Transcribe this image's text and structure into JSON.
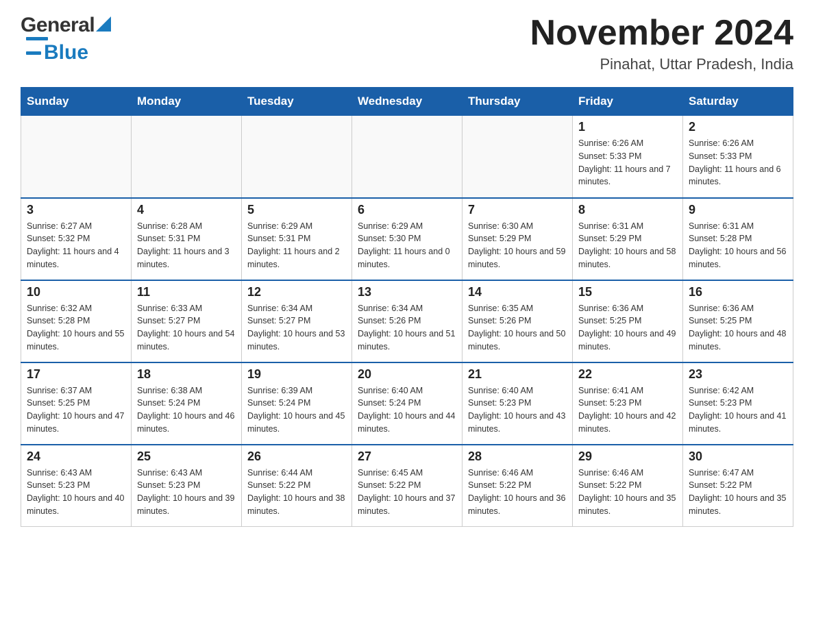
{
  "header": {
    "logo_general": "General",
    "logo_blue": "Blue",
    "month_title": "November 2024",
    "location": "Pinahat, Uttar Pradesh, India"
  },
  "days_of_week": [
    "Sunday",
    "Monday",
    "Tuesday",
    "Wednesday",
    "Thursday",
    "Friday",
    "Saturday"
  ],
  "weeks": [
    {
      "days": [
        {
          "num": "",
          "info": ""
        },
        {
          "num": "",
          "info": ""
        },
        {
          "num": "",
          "info": ""
        },
        {
          "num": "",
          "info": ""
        },
        {
          "num": "",
          "info": ""
        },
        {
          "num": "1",
          "info": "Sunrise: 6:26 AM\nSunset: 5:33 PM\nDaylight: 11 hours and 7 minutes."
        },
        {
          "num": "2",
          "info": "Sunrise: 6:26 AM\nSunset: 5:33 PM\nDaylight: 11 hours and 6 minutes."
        }
      ]
    },
    {
      "days": [
        {
          "num": "3",
          "info": "Sunrise: 6:27 AM\nSunset: 5:32 PM\nDaylight: 11 hours and 4 minutes."
        },
        {
          "num": "4",
          "info": "Sunrise: 6:28 AM\nSunset: 5:31 PM\nDaylight: 11 hours and 3 minutes."
        },
        {
          "num": "5",
          "info": "Sunrise: 6:29 AM\nSunset: 5:31 PM\nDaylight: 11 hours and 2 minutes."
        },
        {
          "num": "6",
          "info": "Sunrise: 6:29 AM\nSunset: 5:30 PM\nDaylight: 11 hours and 0 minutes."
        },
        {
          "num": "7",
          "info": "Sunrise: 6:30 AM\nSunset: 5:29 PM\nDaylight: 10 hours and 59 minutes."
        },
        {
          "num": "8",
          "info": "Sunrise: 6:31 AM\nSunset: 5:29 PM\nDaylight: 10 hours and 58 minutes."
        },
        {
          "num": "9",
          "info": "Sunrise: 6:31 AM\nSunset: 5:28 PM\nDaylight: 10 hours and 56 minutes."
        }
      ]
    },
    {
      "days": [
        {
          "num": "10",
          "info": "Sunrise: 6:32 AM\nSunset: 5:28 PM\nDaylight: 10 hours and 55 minutes."
        },
        {
          "num": "11",
          "info": "Sunrise: 6:33 AM\nSunset: 5:27 PM\nDaylight: 10 hours and 54 minutes."
        },
        {
          "num": "12",
          "info": "Sunrise: 6:34 AM\nSunset: 5:27 PM\nDaylight: 10 hours and 53 minutes."
        },
        {
          "num": "13",
          "info": "Sunrise: 6:34 AM\nSunset: 5:26 PM\nDaylight: 10 hours and 51 minutes."
        },
        {
          "num": "14",
          "info": "Sunrise: 6:35 AM\nSunset: 5:26 PM\nDaylight: 10 hours and 50 minutes."
        },
        {
          "num": "15",
          "info": "Sunrise: 6:36 AM\nSunset: 5:25 PM\nDaylight: 10 hours and 49 minutes."
        },
        {
          "num": "16",
          "info": "Sunrise: 6:36 AM\nSunset: 5:25 PM\nDaylight: 10 hours and 48 minutes."
        }
      ]
    },
    {
      "days": [
        {
          "num": "17",
          "info": "Sunrise: 6:37 AM\nSunset: 5:25 PM\nDaylight: 10 hours and 47 minutes."
        },
        {
          "num": "18",
          "info": "Sunrise: 6:38 AM\nSunset: 5:24 PM\nDaylight: 10 hours and 46 minutes."
        },
        {
          "num": "19",
          "info": "Sunrise: 6:39 AM\nSunset: 5:24 PM\nDaylight: 10 hours and 45 minutes."
        },
        {
          "num": "20",
          "info": "Sunrise: 6:40 AM\nSunset: 5:24 PM\nDaylight: 10 hours and 44 minutes."
        },
        {
          "num": "21",
          "info": "Sunrise: 6:40 AM\nSunset: 5:23 PM\nDaylight: 10 hours and 43 minutes."
        },
        {
          "num": "22",
          "info": "Sunrise: 6:41 AM\nSunset: 5:23 PM\nDaylight: 10 hours and 42 minutes."
        },
        {
          "num": "23",
          "info": "Sunrise: 6:42 AM\nSunset: 5:23 PM\nDaylight: 10 hours and 41 minutes."
        }
      ]
    },
    {
      "days": [
        {
          "num": "24",
          "info": "Sunrise: 6:43 AM\nSunset: 5:23 PM\nDaylight: 10 hours and 40 minutes."
        },
        {
          "num": "25",
          "info": "Sunrise: 6:43 AM\nSunset: 5:23 PM\nDaylight: 10 hours and 39 minutes."
        },
        {
          "num": "26",
          "info": "Sunrise: 6:44 AM\nSunset: 5:22 PM\nDaylight: 10 hours and 38 minutes."
        },
        {
          "num": "27",
          "info": "Sunrise: 6:45 AM\nSunset: 5:22 PM\nDaylight: 10 hours and 37 minutes."
        },
        {
          "num": "28",
          "info": "Sunrise: 6:46 AM\nSunset: 5:22 PM\nDaylight: 10 hours and 36 minutes."
        },
        {
          "num": "29",
          "info": "Sunrise: 6:46 AM\nSunset: 5:22 PM\nDaylight: 10 hours and 35 minutes."
        },
        {
          "num": "30",
          "info": "Sunrise: 6:47 AM\nSunset: 5:22 PM\nDaylight: 10 hours and 35 minutes."
        }
      ]
    }
  ]
}
